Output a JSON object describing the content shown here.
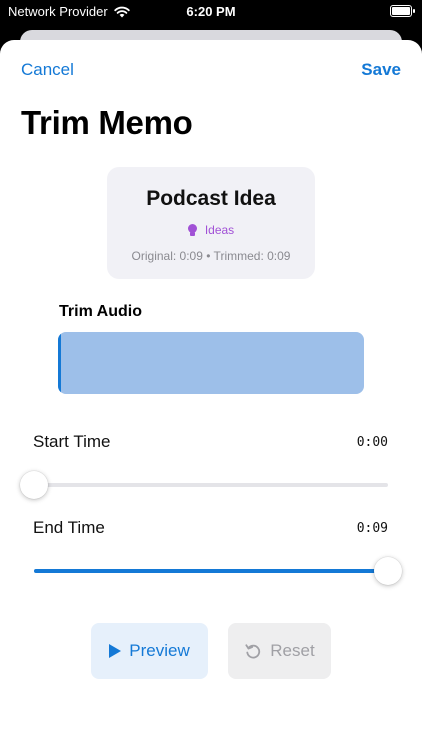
{
  "status_bar": {
    "carrier": "Network Provider",
    "time": "6:20 PM"
  },
  "nav": {
    "cancel_label": "Cancel",
    "save_label": "Save"
  },
  "page_title": "Trim Memo",
  "memo": {
    "title": "Podcast Idea",
    "category": "Ideas",
    "category_icon": "lightbulb-icon",
    "category_color": "#a151d6",
    "durations": "Original: 0:09 • Trimmed: 0:09"
  },
  "trim": {
    "label": "Trim Audio"
  },
  "start_time": {
    "label": "Start Time",
    "value": "0:00",
    "level": 0
  },
  "end_time": {
    "label": "End Time",
    "value": "0:09",
    "level": 1
  },
  "actions": {
    "preview_label": "Preview",
    "reset_label": "Reset"
  },
  "colors": {
    "accent": "#1479d6",
    "trim_fill": "#9dbfe9",
    "disabled": "#a0a0a5"
  }
}
